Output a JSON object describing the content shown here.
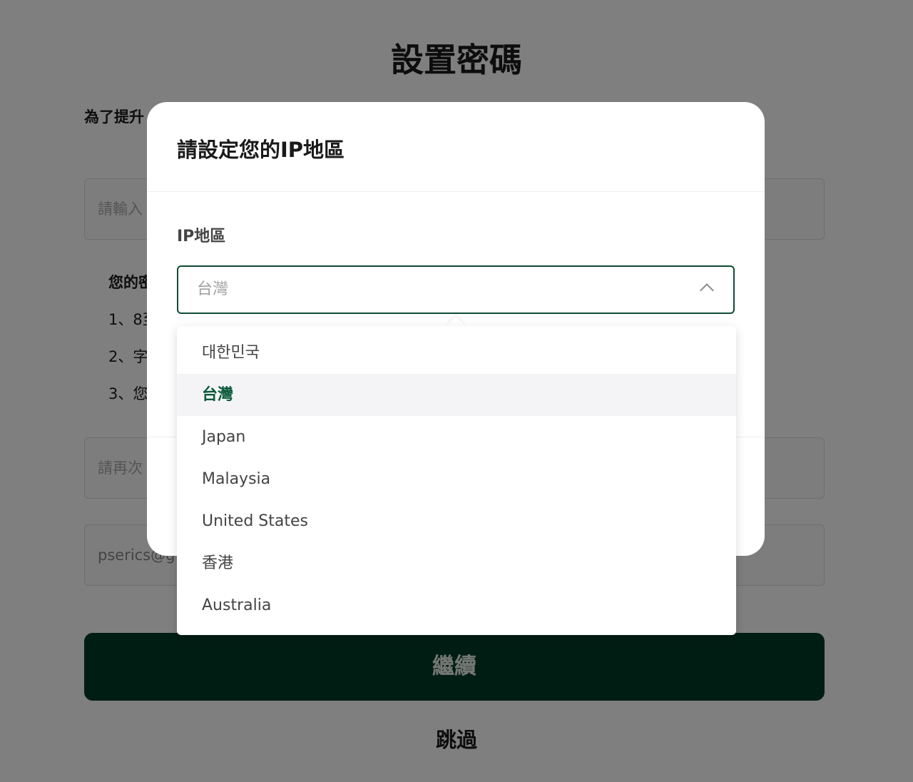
{
  "page": {
    "title": "設置密碼",
    "intro": "為了提升",
    "password_placeholder": "請輸入",
    "rules_title": "您的密",
    "rules": [
      "1、8至",
      "2、字",
      "3、您"
    ],
    "confirm_placeholder": "請再次",
    "email_value": "pserics@g",
    "continue_label": "繼續",
    "skip_label": "跳過"
  },
  "modal": {
    "title": "請設定您的IP地區",
    "field_label": "IP地區",
    "selected_value": "台灣",
    "chevron_icon": "chevron-up-icon"
  },
  "dropdown": {
    "options": [
      {
        "label": "대한민국",
        "selected": false
      },
      {
        "label": "台灣",
        "selected": true
      },
      {
        "label": "Japan",
        "selected": false
      },
      {
        "label": "Malaysia",
        "selected": false
      },
      {
        "label": "United States",
        "selected": false
      },
      {
        "label": "香港",
        "selected": false
      },
      {
        "label": "Australia",
        "selected": false
      }
    ]
  },
  "colors": {
    "brand_green": "#003b28",
    "selected_text": "#0b5a3a",
    "overlay": "rgba(0,0,0,0.5)"
  }
}
